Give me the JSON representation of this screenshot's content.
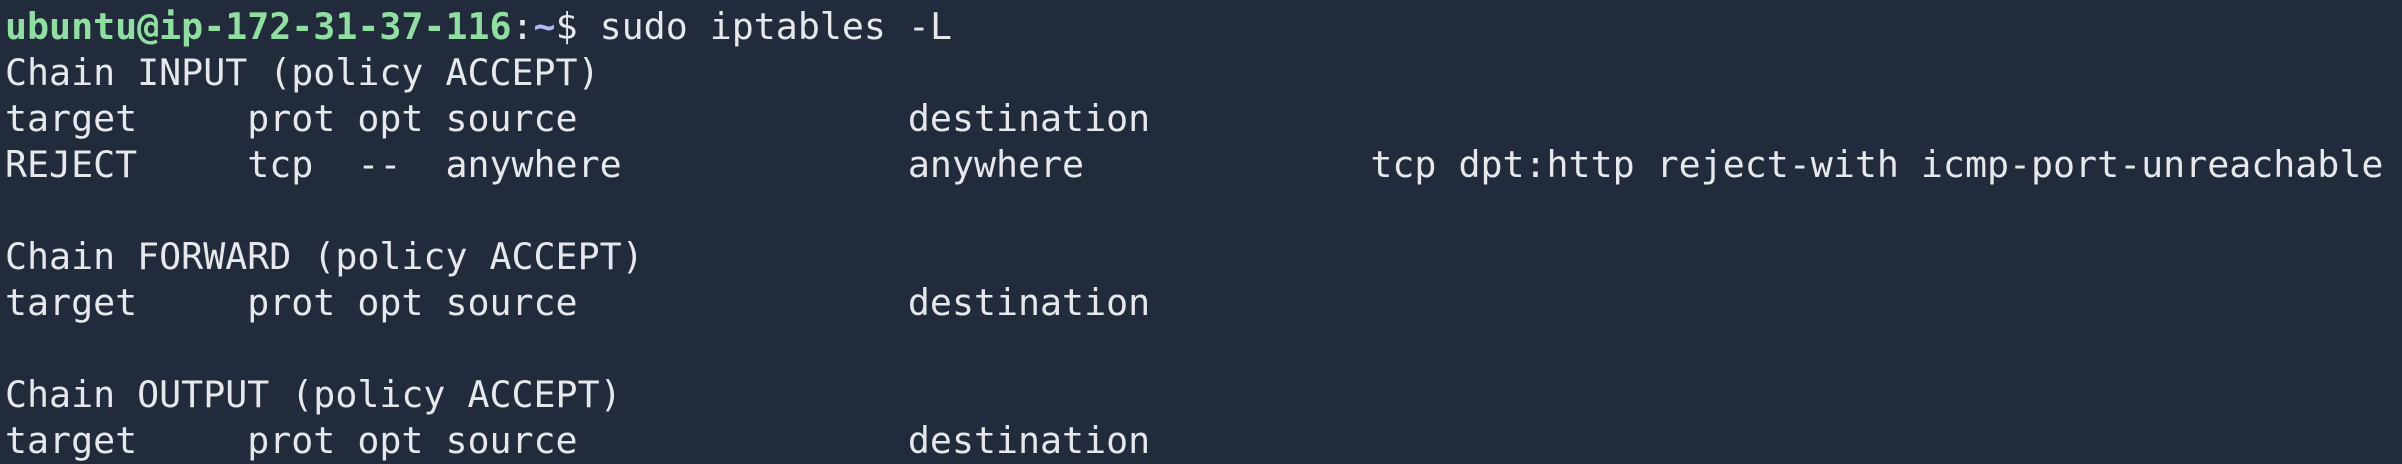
{
  "prompt": {
    "user_host": "ubuntu@ip-172-31-37-116",
    "separator": ":",
    "cwd": "~",
    "symbol": "$ ",
    "command": "sudo iptables -L"
  },
  "output_lines": [
    "Chain INPUT (policy ACCEPT)",
    "target     prot opt source               destination",
    "REJECT     tcp  --  anywhere             anywhere             tcp dpt:http reject-with icmp-port-unreachable",
    "",
    "Chain FORWARD (policy ACCEPT)",
    "target     prot opt source               destination",
    "",
    "Chain OUTPUT (policy ACCEPT)",
    "target     prot opt source               destination"
  ],
  "colors": {
    "background": "#222b3c",
    "text": "#e6e8ec",
    "user_host": "#8fe0a0",
    "cwd": "#b7b5f5"
  }
}
